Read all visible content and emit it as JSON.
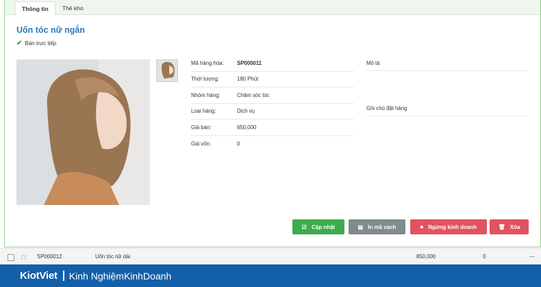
{
  "tabs": [
    {
      "label": "Thông tin",
      "active": true
    },
    {
      "label": "Thẻ kho",
      "active": false
    }
  ],
  "product": {
    "title": "Uốn tóc nữ ngắn",
    "sale_status": "Bán trực tiếp",
    "fields": [
      {
        "label": "Mã hàng hóa:",
        "value": "SP000011"
      },
      {
        "label": "Thời lượng:",
        "value": "180 Phút"
      },
      {
        "label": "Nhóm hàng:",
        "value": "Chăm sóc tóc"
      },
      {
        "label": "Loại hàng:",
        "value": "Dịch vụ"
      },
      {
        "label": "Giá bán:",
        "value": "650,000"
      },
      {
        "label": "Giá vốn:",
        "value": "0"
      }
    ],
    "description_label": "Mô tả",
    "order_note_label": "Ghi chú đặt hàng"
  },
  "actions": {
    "update": "Cập nhật",
    "print_barcode": "In mã vạch",
    "stop_selling": "Ngừng kinh doanh",
    "delete": "Xóa"
  },
  "list_row": {
    "code": "SP000012",
    "name": "Uốn tóc nữ dài",
    "price": "850,000",
    "stock": "0",
    "more": "---"
  },
  "footer": {
    "brand": "KiotViet",
    "slogan": "Kinh NghiệmKinhDoanh"
  },
  "colors": {
    "title": "#2d78b8",
    "update_button": "#3cac4c",
    "barcode_button": "#7f8b8c",
    "danger_button": "#e2525f",
    "footer": "#1460a8"
  }
}
